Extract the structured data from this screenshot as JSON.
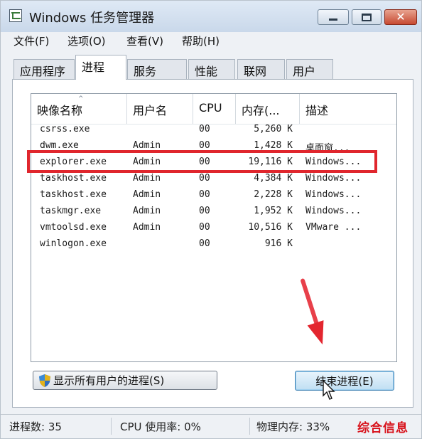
{
  "window": {
    "title": "Windows 任务管理器"
  },
  "menu": [
    {
      "label": "文件(F)"
    },
    {
      "label": "选项(O)"
    },
    {
      "label": "查看(V)"
    },
    {
      "label": "帮助(H)"
    }
  ],
  "tabs": [
    {
      "label": "应用程序",
      "active": false
    },
    {
      "label": "进程",
      "active": true
    },
    {
      "label": "服务",
      "active": false
    },
    {
      "label": "性能",
      "active": false
    },
    {
      "label": "联网",
      "active": false
    },
    {
      "label": "用户",
      "active": false
    }
  ],
  "process_table": {
    "columns": [
      "映像名称",
      "用户名",
      "CPU",
      "内存(...",
      "描述"
    ],
    "rows": [
      {
        "name": "csrss.exe",
        "user": "",
        "cpu": "00",
        "memory": "5,260 K",
        "description": ""
      },
      {
        "name": "dwm.exe",
        "user": "Admin",
        "cpu": "00",
        "memory": "1,428 K",
        "description": "桌面窗..."
      },
      {
        "name": "explorer.exe",
        "user": "Admin",
        "cpu": "00",
        "memory": "19,116 K",
        "description": "Windows..."
      },
      {
        "name": "taskhost.exe",
        "user": "Admin",
        "cpu": "00",
        "memory": "4,384 K",
        "description": "Windows..."
      },
      {
        "name": "taskhost.exe",
        "user": "Admin",
        "cpu": "00",
        "memory": "2,228 K",
        "description": "Windows..."
      },
      {
        "name": "taskmgr.exe",
        "user": "Admin",
        "cpu": "00",
        "memory": "1,952 K",
        "description": "Windows..."
      },
      {
        "name": "vmtoolsd.exe",
        "user": "Admin",
        "cpu": "00",
        "memory": "10,516 K",
        "description": "VMware ..."
      },
      {
        "name": "winlogon.exe",
        "user": "",
        "cpu": "00",
        "memory": "916 K",
        "description": ""
      }
    ],
    "highlighted_row": "explorer.exe"
  },
  "buttons": {
    "show_all_users": "显示所有用户的进程(S)",
    "end_process": "结束进程(E)"
  },
  "status": {
    "processes": "进程数: 35",
    "cpu": "CPU 使用率: 0%",
    "memory": "物理内存: 33%"
  },
  "watermark": "综合信息",
  "colors": {
    "highlight": "#e0262d",
    "arrow": "#e3262f",
    "watermark": "#d8121b"
  },
  "icons": [
    "app-icon",
    "minimize-icon",
    "maximize-icon",
    "close-icon",
    "uac-shield-icon",
    "mouse-cursor-icon",
    "red-arrow-annotation"
  ]
}
